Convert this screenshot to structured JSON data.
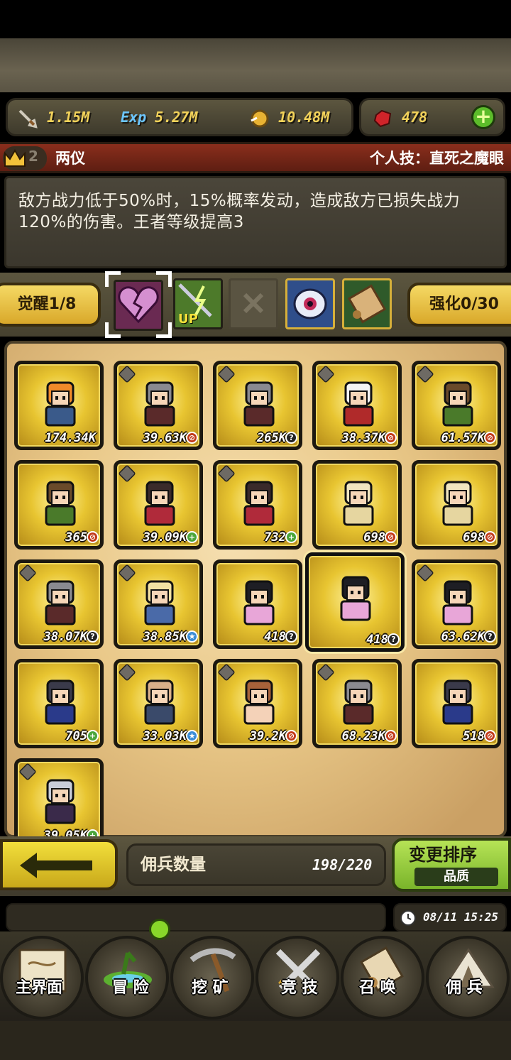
{
  "resources": {
    "attack": "1.15M",
    "exp_label": "Exp",
    "exp": "5.27M",
    "gold": "10.48M",
    "gems": "478"
  },
  "skill": {
    "rank": "2",
    "name": "两仪",
    "label": "个人技：直死之魔眼"
  },
  "description": "敌方战力低于50%时，15%概率发动，造成敌方已损失战力120%的伤害。王者等级提高3",
  "awaken": "觉醒1/8",
  "enhance": "强化0/30",
  "up_label": "UP",
  "mercenaries": [
    {
      "value": "174.34K",
      "badge": "",
      "color": "orange"
    },
    {
      "value": "39.63K",
      "badge": "red",
      "color": "gray"
    },
    {
      "value": "265K",
      "badge": "dark",
      "color": "gray"
    },
    {
      "value": "38.37K",
      "badge": "red",
      "color": "white"
    },
    {
      "value": "61.57K",
      "badge": "red",
      "color": "green"
    },
    {
      "value": "365",
      "badge": "red",
      "color": "green"
    },
    {
      "value": "39.09K",
      "badge": "green",
      "color": "red"
    },
    {
      "value": "732",
      "badge": "green",
      "color": "red"
    },
    {
      "value": "698",
      "badge": "red",
      "color": "cream"
    },
    {
      "value": "698",
      "badge": "red",
      "color": "cream"
    },
    {
      "value": "38.07K",
      "badge": "dark",
      "color": "gray"
    },
    {
      "value": "38.85K",
      "badge": "blue",
      "color": "blonde"
    },
    {
      "value": "418",
      "badge": "dark",
      "color": "dark"
    },
    {
      "value": "418",
      "badge": "dark",
      "color": "dark"
    },
    {
      "value": "63.62K",
      "badge": "dark",
      "color": "dark"
    },
    {
      "value": "705",
      "badge": "green",
      "color": "navy"
    },
    {
      "value": "33.03K",
      "badge": "blue",
      "color": "bald"
    },
    {
      "value": "39.2K",
      "badge": "red",
      "color": "brown"
    },
    {
      "value": "68.23K",
      "badge": "red",
      "color": "gray"
    },
    {
      "value": "518",
      "badge": "red",
      "color": "navy"
    },
    {
      "value": "39.05K",
      "badge": "green",
      "color": "silver"
    }
  ],
  "count": {
    "label": "佣兵数量",
    "value": "198/220"
  },
  "sort": {
    "title": "变更排序",
    "sub": "品质"
  },
  "time": "08/11 15:25",
  "nav": [
    {
      "label": "主界面"
    },
    {
      "label": "冒 险"
    },
    {
      "label": "挖 矿"
    },
    {
      "label": "竞 技"
    },
    {
      "label": "召 唤"
    },
    {
      "label": "佣 兵"
    }
  ]
}
